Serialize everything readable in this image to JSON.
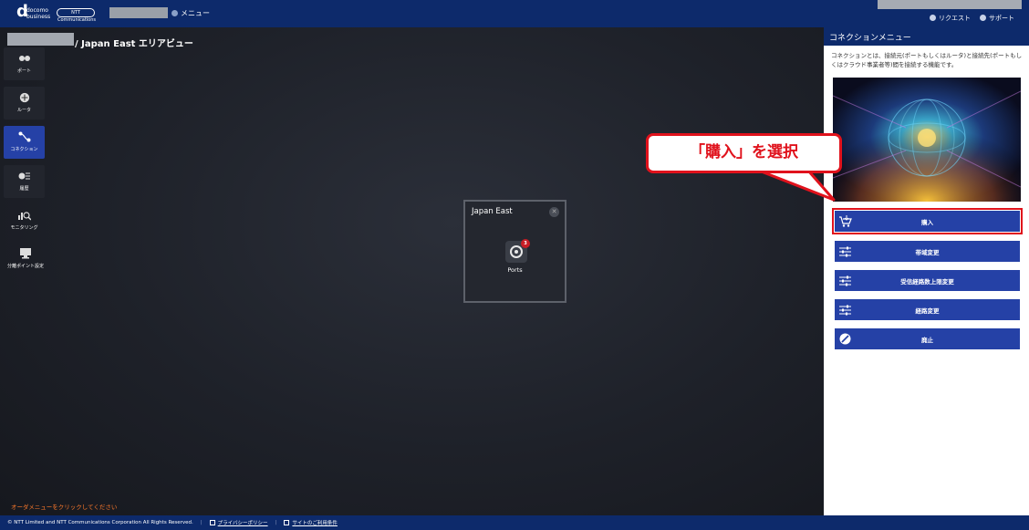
{
  "header": {
    "logo_brand": "docomo business",
    "ntt_logo": "NTT Communications",
    "menu_label": "メニュー",
    "request_label": "リクエスト",
    "support_label": "サポート"
  },
  "breadcrumb": "/ Japan East エリアビュー",
  "sidebar": {
    "items": [
      {
        "label": "ポート",
        "icon": "port-icon"
      },
      {
        "label": "ルータ",
        "icon": "router-icon"
      },
      {
        "label": "コネクション",
        "icon": "connection-icon",
        "active": true
      },
      {
        "label": "履歴",
        "icon": "history-icon"
      },
      {
        "label": "モニタリング",
        "icon": "monitoring-icon"
      },
      {
        "label": "分離ポイント設定",
        "icon": "demarcation-icon"
      }
    ]
  },
  "region": {
    "title": "Japan East",
    "port_badge": "3",
    "port_label": "Ports"
  },
  "order_hint": "オーダメニューをクリックしてください",
  "panel": {
    "title": "コネクションメニュー",
    "description": "コネクションとは、接続元(ポートもしくはルータ)と接続先(ポートもしくはクラウド事業者等)間を接続する機能です。",
    "actions": [
      {
        "label": "購入",
        "icon": "cart-icon"
      },
      {
        "label": "帯域変更",
        "icon": "sliders-icon"
      },
      {
        "label": "受信経路数上限変更",
        "icon": "sliders-icon"
      },
      {
        "label": "経路変更",
        "icon": "sliders-icon"
      },
      {
        "label": "廃止",
        "icon": "cancel-icon"
      }
    ]
  },
  "callout": "「購入」を選択",
  "footer": {
    "copyright": "© NTT Limited and NTT Communications Corporation All Rights Reserved.",
    "privacy": "プライバシーポリシー",
    "terms": "サイトのご利用条件"
  },
  "colors": {
    "header_bg": "#0d2a6b",
    "accent_blue": "#2541a6",
    "highlight_red": "#e0121c",
    "hint_orange": "#ff7a2b"
  }
}
